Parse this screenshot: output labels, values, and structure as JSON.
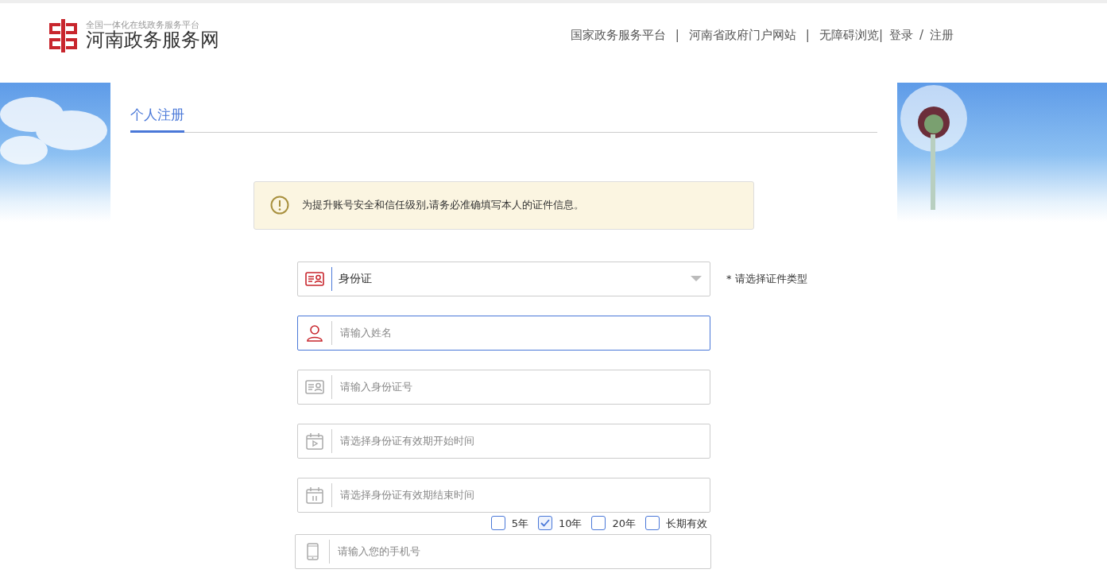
{
  "header": {
    "logo_subtitle": "全国一体化在线政务服务平台",
    "logo_title": "河南政务服务网",
    "nav": [
      {
        "label": "国家政务服务平台",
        "kind": "link"
      },
      {
        "label": "|",
        "kind": "sep"
      },
      {
        "label": "河南省政府门户网站",
        "kind": "link"
      },
      {
        "label": "|",
        "kind": "sep"
      },
      {
        "label": "无障碍浏览|",
        "kind": "link"
      },
      {
        "label": "登录",
        "kind": "link"
      },
      {
        "label": "/",
        "kind": "plain"
      },
      {
        "label": "注册",
        "kind": "link"
      }
    ]
  },
  "tabs": [
    {
      "label": "个人注册",
      "selected": true
    }
  ],
  "alert": {
    "text": "为提升账号安全和信任级别,请务必准确填写本人的证件信息。"
  },
  "fields": [
    {
      "kind": "select",
      "icon_active": true,
      "value": "身份证",
      "hint": "* 请选择证件类型",
      "focused": false
    },
    {
      "kind": "name",
      "icon_active": true,
      "placeholder": "请输入姓名",
      "focused": true
    },
    {
      "kind": "id-number",
      "icon_active": false,
      "placeholder": "请输入身份证号",
      "focused": false
    },
    {
      "kind": "start-date",
      "icon_active": false,
      "placeholder": "请选择身份证有效期开始时间",
      "focused": false
    },
    {
      "kind": "end-date",
      "icon_active": false,
      "placeholder": "请选择身份证有效期结束时间",
      "focused": false
    },
    {
      "kind": "period",
      "options": [
        {
          "label": "5年",
          "selected": false
        },
        {
          "label": "10年",
          "selected": true
        },
        {
          "label": "20年",
          "selected": false
        },
        {
          "label": "长期有效",
          "selected": false
        }
      ]
    },
    {
      "kind": "phone",
      "icon_active": false,
      "placeholder": "请输入您的手机号",
      "focused": false
    }
  ]
}
